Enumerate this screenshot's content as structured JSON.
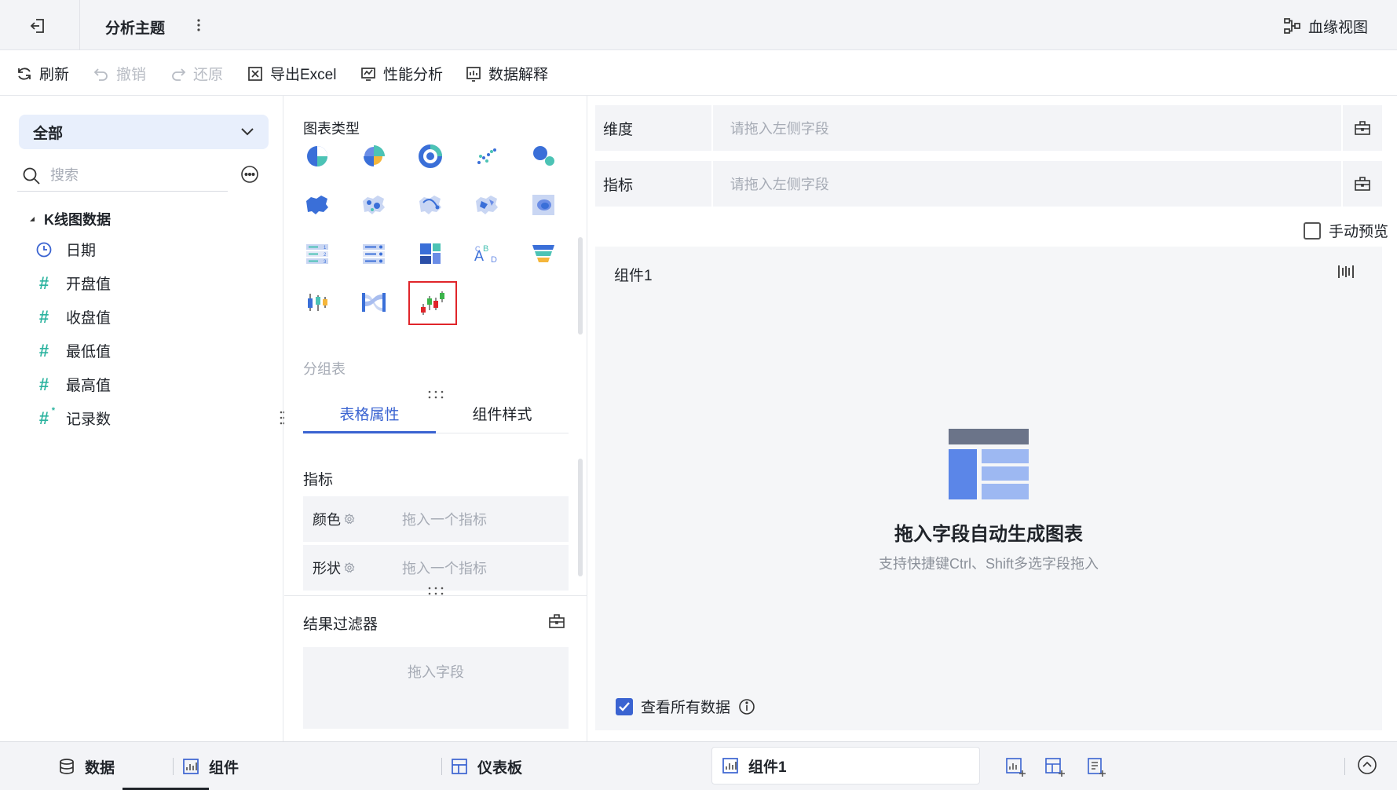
{
  "header": {
    "title": "分析主题",
    "lineage_label": "血缘视图"
  },
  "toolbar": {
    "refresh": "刷新",
    "undo": "撤销",
    "redo": "还原",
    "export_excel": "导出Excel",
    "performance": "性能分析",
    "data_explain": "数据解释"
  },
  "left": {
    "scope": "全部",
    "search_placeholder": "搜索",
    "dataset_name": "K线图数据",
    "fields": [
      {
        "label": "日期",
        "type": "date",
        "icon": "clock-icon"
      },
      {
        "label": "开盘值",
        "type": "number",
        "icon": "hash-icon"
      },
      {
        "label": "收盘值",
        "type": "number",
        "icon": "hash-icon"
      },
      {
        "label": "最低值",
        "type": "number",
        "icon": "hash-icon"
      },
      {
        "label": "最高值",
        "type": "number",
        "icon": "hash-icon"
      },
      {
        "label": "记录数",
        "type": "number",
        "icon": "hash-star-icon"
      }
    ]
  },
  "middle": {
    "chart_type_label": "图表类型",
    "chart_types": [
      "pie-chart-icon",
      "rose-pie-chart-icon",
      "donut-chart-icon",
      "scatter-chart-icon",
      "bubble-chart-icon",
      "area-map-icon",
      "point-map-icon",
      "flow-map-icon",
      "heat-map-icon",
      "contour-map-icon",
      "ranking-table-icon",
      "list-table-icon",
      "treemap-icon",
      "word-cloud-icon",
      "funnel-chart-icon",
      "box-plot-icon",
      "sankey-icon",
      "candlestick-chart-icon"
    ],
    "selected_chart": "candlestick-chart-icon",
    "group_table_label": "分组表",
    "tabs": [
      "表格属性",
      "组件样式"
    ],
    "active_tab": "表格属性",
    "metrics_section": "指标",
    "props": [
      {
        "label": "颜色",
        "placeholder": "拖入一个指标"
      },
      {
        "label": "形状",
        "placeholder": "拖入一个指标"
      }
    ],
    "filter_label": "结果过滤器",
    "filter_placeholder": "拖入字段"
  },
  "right": {
    "dimension_label": "维度",
    "dimension_placeholder": "请拖入左侧字段",
    "metric_label": "指标",
    "metric_placeholder": "请拖入左侧字段",
    "manual_preview": "手动预览",
    "component_title": "组件1",
    "empty_title": "拖入字段自动生成图表",
    "empty_subtitle": "支持快捷键Ctrl、Shift多选字段拖入",
    "view_all_data": "查看所有数据",
    "view_all_checked": true
  },
  "bottom": {
    "data_tab": "数据",
    "component_tab": "组件",
    "dashboard_tab": "仪表板",
    "current_component": "组件1"
  },
  "colors": {
    "accent": "#3a63d1",
    "selected_border": "#e0252a",
    "field_number": "#2bb39f",
    "field_date": "#3a63d1"
  }
}
